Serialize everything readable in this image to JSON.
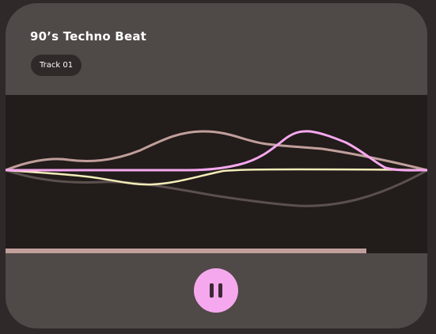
{
  "track": {
    "title": "90’s Techno Beat",
    "badge": "Track 01"
  },
  "playback": {
    "state": "playing",
    "progress": 0.856
  },
  "colors": {
    "card": "#4f4948",
    "visualizer_bg": "#221c1b",
    "accent_pink": "#f6a8ee",
    "wave_rose": "#c19f9b",
    "wave_cream": "#f3ecb8",
    "wave_dark": "#5b504e",
    "progress": "#c19f9b"
  },
  "icons": {
    "play_pause": "pause-icon"
  }
}
